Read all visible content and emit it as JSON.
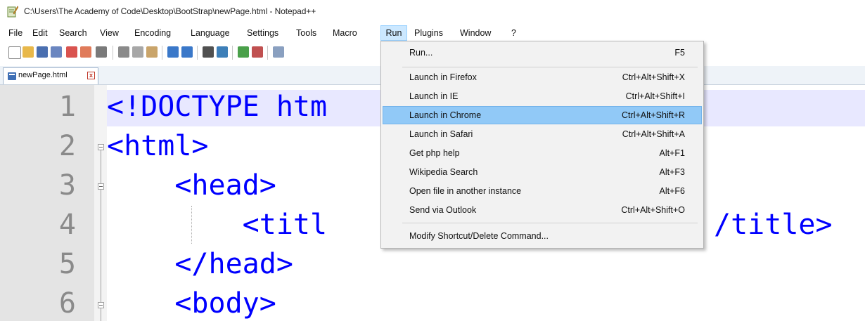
{
  "window": {
    "title": "C:\\Users\\The Academy of Code\\Desktop\\BootStrap\\newPage.html - Notepad++"
  },
  "menubar": {
    "items": [
      {
        "label": "File"
      },
      {
        "label": "Edit"
      },
      {
        "label": "Search"
      },
      {
        "label": "View"
      },
      {
        "label": "Encoding"
      },
      {
        "label": "Language"
      },
      {
        "label": "Settings"
      },
      {
        "label": "Tools"
      },
      {
        "label": "Macro"
      },
      {
        "label": "Run"
      },
      {
        "label": "Plugins"
      },
      {
        "label": "Window"
      },
      {
        "label": "?"
      }
    ],
    "active": "Run"
  },
  "toolbar": {
    "icons": [
      "new-file-icon",
      "open-file-icon",
      "save-icon",
      "save-all-icon",
      "close-icon",
      "close-all-icon",
      "print-icon",
      "cut-icon",
      "copy-icon",
      "paste-icon",
      "undo-icon",
      "redo-icon",
      "find-icon",
      "replace-icon",
      "zoom-in-icon",
      "zoom-out-icon",
      "sync-scroll-icon"
    ]
  },
  "tabs": [
    {
      "label": "newPage.html",
      "close": "x"
    }
  ],
  "editor": {
    "lines": [
      {
        "number": "1",
        "text": "<!DOCTYPE htm"
      },
      {
        "number": "2",
        "text": "<html>"
      },
      {
        "number": "3",
        "text": "    <head>"
      },
      {
        "number": "4",
        "text": "        <titl"
      },
      {
        "number": "5",
        "text": "    </head>"
      },
      {
        "number": "6",
        "text": "    <body>"
      }
    ],
    "line4_tail": "/title>"
  },
  "run_menu": {
    "items": [
      {
        "label": "Run...",
        "shortcut": "F5"
      },
      {
        "label": "Launch in Firefox",
        "shortcut": "Ctrl+Alt+Shift+X"
      },
      {
        "label": "Launch in IE",
        "shortcut": "Ctrl+Alt+Shift+I"
      },
      {
        "label": "Launch in Chrome",
        "shortcut": "Ctrl+Alt+Shift+R"
      },
      {
        "label": "Launch in Safari",
        "shortcut": "Ctrl+Alt+Shift+A"
      },
      {
        "label": "Get php help",
        "shortcut": "Alt+F1"
      },
      {
        "label": "Wikipedia Search",
        "shortcut": "Alt+F3"
      },
      {
        "label": "Open file in another instance",
        "shortcut": "Alt+F6"
      },
      {
        "label": "Send via Outlook",
        "shortcut": "Ctrl+Alt+Shift+O"
      },
      {
        "label": "Modify Shortcut/Delete Command...",
        "shortcut": ""
      }
    ],
    "highlighted": "Launch in Chrome"
  },
  "colors": {
    "code_blue": "#0000ff",
    "line_highlight": "#e8e8ff",
    "menu_highlight": "#91c9f7"
  }
}
